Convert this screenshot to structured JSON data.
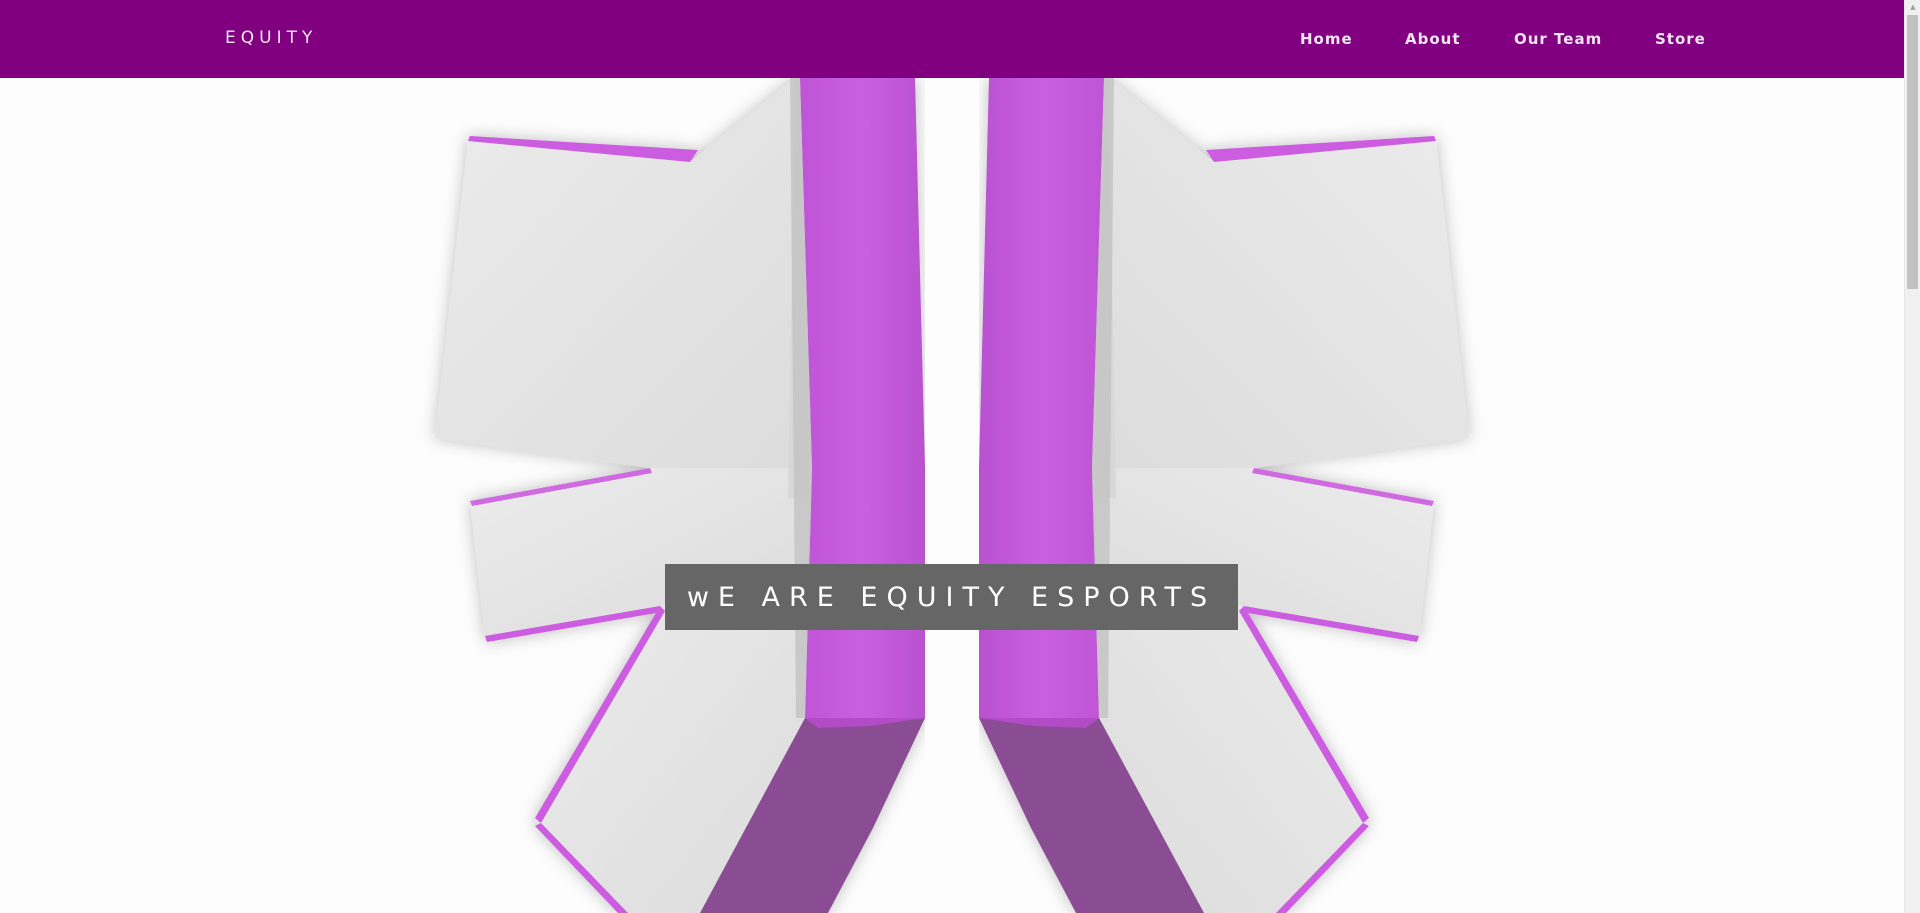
{
  "nav": {
    "brand": "EQUITY",
    "items": [
      {
        "label": "Home"
      },
      {
        "label": "About"
      },
      {
        "label": "Our Team"
      },
      {
        "label": "Store"
      }
    ]
  },
  "hero": {
    "tagline": "wE ARE EQUITY ESPORTS",
    "logo_icon": "equity-logo-icon"
  },
  "colors": {
    "brand_purple": "#800080",
    "logo_magenta": "#cc5ce0",
    "logo_dark_magenta": "#8a4d93",
    "logo_marble": "#e6e6e6",
    "tagline_background": "#666666"
  }
}
